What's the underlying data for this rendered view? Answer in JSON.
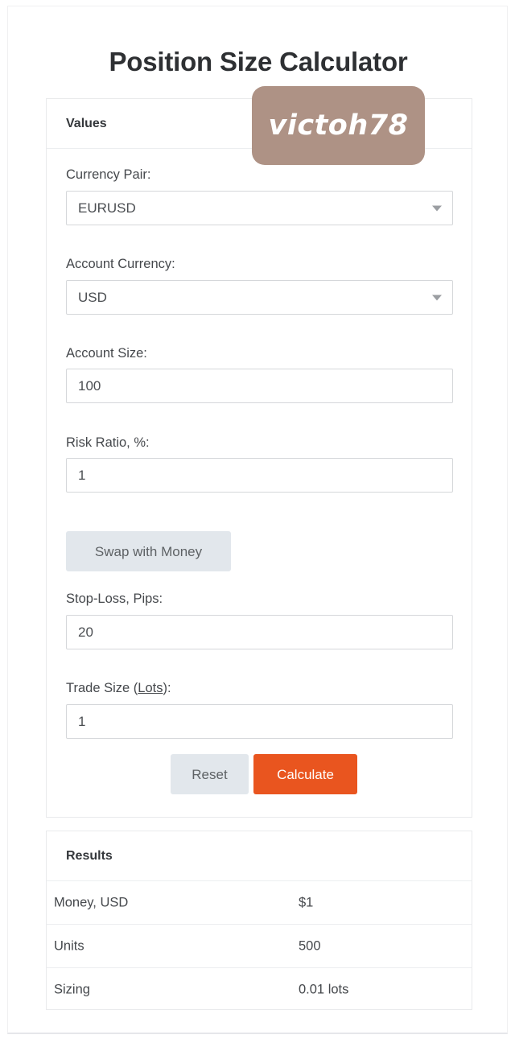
{
  "page": {
    "title": "Position Size Calculator"
  },
  "watermark": {
    "text": "victoh78",
    "bg_color": "#ae9285",
    "text_color": "#ffffff"
  },
  "values_card": {
    "header": "Values",
    "fields": [
      {
        "label": "Currency Pair:",
        "type": "select",
        "value": "EURUSD",
        "icon": "chevron-down-icon"
      },
      {
        "label": "Account Currency:",
        "type": "select",
        "value": "USD",
        "icon": "chevron-down-icon"
      },
      {
        "label": "Account Size:",
        "type": "text",
        "value": "100"
      },
      {
        "label": "Risk Ratio, %:",
        "type": "text",
        "value": "1"
      }
    ],
    "swap_button": "Swap with Money",
    "stop_loss": {
      "label": "Stop-Loss, Pips:",
      "value": "20"
    },
    "trade_size": {
      "label_prefix": "Trade Size (",
      "label_underlined": "Lots",
      "label_suffix": "):",
      "value": "1"
    },
    "reset_button": "Reset",
    "calculate_button": "Calculate"
  },
  "results_card": {
    "header": "Results",
    "rows": [
      {
        "key": "Money, USD",
        "value": "$1"
      },
      {
        "key": "Units",
        "value": "500"
      },
      {
        "key": "Sizing",
        "value": "0.01 lots"
      }
    ]
  },
  "colors": {
    "accent_orange": "#e9551f",
    "button_grey": "#e2e7ec",
    "text": "#45484c"
  }
}
